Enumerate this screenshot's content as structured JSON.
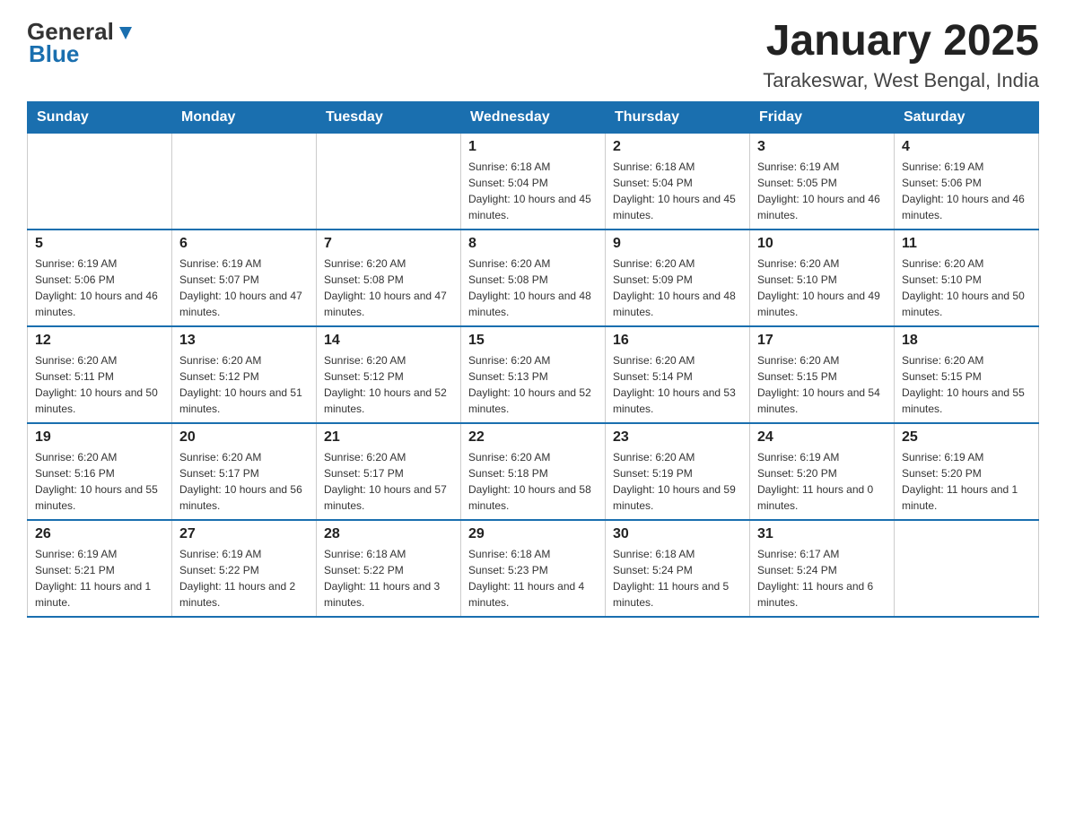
{
  "logo": {
    "text_general": "General",
    "text_blue": "Blue"
  },
  "header": {
    "title": "January 2025",
    "subtitle": "Tarakeswar, West Bengal, India"
  },
  "calendar": {
    "days_of_week": [
      "Sunday",
      "Monday",
      "Tuesday",
      "Wednesday",
      "Thursday",
      "Friday",
      "Saturday"
    ],
    "weeks": [
      [
        {
          "day": "",
          "info": ""
        },
        {
          "day": "",
          "info": ""
        },
        {
          "day": "",
          "info": ""
        },
        {
          "day": "1",
          "info": "Sunrise: 6:18 AM\nSunset: 5:04 PM\nDaylight: 10 hours and 45 minutes."
        },
        {
          "day": "2",
          "info": "Sunrise: 6:18 AM\nSunset: 5:04 PM\nDaylight: 10 hours and 45 minutes."
        },
        {
          "day": "3",
          "info": "Sunrise: 6:19 AM\nSunset: 5:05 PM\nDaylight: 10 hours and 46 minutes."
        },
        {
          "day": "4",
          "info": "Sunrise: 6:19 AM\nSunset: 5:06 PM\nDaylight: 10 hours and 46 minutes."
        }
      ],
      [
        {
          "day": "5",
          "info": "Sunrise: 6:19 AM\nSunset: 5:06 PM\nDaylight: 10 hours and 46 minutes."
        },
        {
          "day": "6",
          "info": "Sunrise: 6:19 AM\nSunset: 5:07 PM\nDaylight: 10 hours and 47 minutes."
        },
        {
          "day": "7",
          "info": "Sunrise: 6:20 AM\nSunset: 5:08 PM\nDaylight: 10 hours and 47 minutes."
        },
        {
          "day": "8",
          "info": "Sunrise: 6:20 AM\nSunset: 5:08 PM\nDaylight: 10 hours and 48 minutes."
        },
        {
          "day": "9",
          "info": "Sunrise: 6:20 AM\nSunset: 5:09 PM\nDaylight: 10 hours and 48 minutes."
        },
        {
          "day": "10",
          "info": "Sunrise: 6:20 AM\nSunset: 5:10 PM\nDaylight: 10 hours and 49 minutes."
        },
        {
          "day": "11",
          "info": "Sunrise: 6:20 AM\nSunset: 5:10 PM\nDaylight: 10 hours and 50 minutes."
        }
      ],
      [
        {
          "day": "12",
          "info": "Sunrise: 6:20 AM\nSunset: 5:11 PM\nDaylight: 10 hours and 50 minutes."
        },
        {
          "day": "13",
          "info": "Sunrise: 6:20 AM\nSunset: 5:12 PM\nDaylight: 10 hours and 51 minutes."
        },
        {
          "day": "14",
          "info": "Sunrise: 6:20 AM\nSunset: 5:12 PM\nDaylight: 10 hours and 52 minutes."
        },
        {
          "day": "15",
          "info": "Sunrise: 6:20 AM\nSunset: 5:13 PM\nDaylight: 10 hours and 52 minutes."
        },
        {
          "day": "16",
          "info": "Sunrise: 6:20 AM\nSunset: 5:14 PM\nDaylight: 10 hours and 53 minutes."
        },
        {
          "day": "17",
          "info": "Sunrise: 6:20 AM\nSunset: 5:15 PM\nDaylight: 10 hours and 54 minutes."
        },
        {
          "day": "18",
          "info": "Sunrise: 6:20 AM\nSunset: 5:15 PM\nDaylight: 10 hours and 55 minutes."
        }
      ],
      [
        {
          "day": "19",
          "info": "Sunrise: 6:20 AM\nSunset: 5:16 PM\nDaylight: 10 hours and 55 minutes."
        },
        {
          "day": "20",
          "info": "Sunrise: 6:20 AM\nSunset: 5:17 PM\nDaylight: 10 hours and 56 minutes."
        },
        {
          "day": "21",
          "info": "Sunrise: 6:20 AM\nSunset: 5:17 PM\nDaylight: 10 hours and 57 minutes."
        },
        {
          "day": "22",
          "info": "Sunrise: 6:20 AM\nSunset: 5:18 PM\nDaylight: 10 hours and 58 minutes."
        },
        {
          "day": "23",
          "info": "Sunrise: 6:20 AM\nSunset: 5:19 PM\nDaylight: 10 hours and 59 minutes."
        },
        {
          "day": "24",
          "info": "Sunrise: 6:19 AM\nSunset: 5:20 PM\nDaylight: 11 hours and 0 minutes."
        },
        {
          "day": "25",
          "info": "Sunrise: 6:19 AM\nSunset: 5:20 PM\nDaylight: 11 hours and 1 minute."
        }
      ],
      [
        {
          "day": "26",
          "info": "Sunrise: 6:19 AM\nSunset: 5:21 PM\nDaylight: 11 hours and 1 minute."
        },
        {
          "day": "27",
          "info": "Sunrise: 6:19 AM\nSunset: 5:22 PM\nDaylight: 11 hours and 2 minutes."
        },
        {
          "day": "28",
          "info": "Sunrise: 6:18 AM\nSunset: 5:22 PM\nDaylight: 11 hours and 3 minutes."
        },
        {
          "day": "29",
          "info": "Sunrise: 6:18 AM\nSunset: 5:23 PM\nDaylight: 11 hours and 4 minutes."
        },
        {
          "day": "30",
          "info": "Sunrise: 6:18 AM\nSunset: 5:24 PM\nDaylight: 11 hours and 5 minutes."
        },
        {
          "day": "31",
          "info": "Sunrise: 6:17 AM\nSunset: 5:24 PM\nDaylight: 11 hours and 6 minutes."
        },
        {
          "day": "",
          "info": ""
        }
      ]
    ]
  }
}
